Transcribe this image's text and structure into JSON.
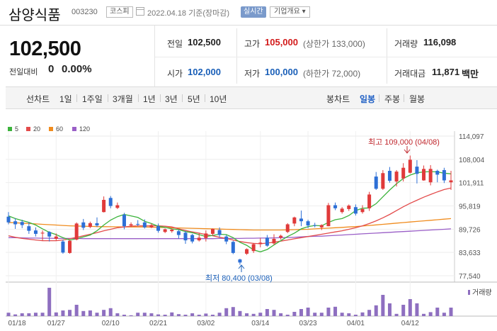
{
  "header": {
    "title": "삼양식품",
    "code": "003230",
    "market": "코스피",
    "date_text": "2022.04.18  기준(장마감)",
    "live_label": "실시간",
    "overview_label": "기업개요"
  },
  "summary": {
    "price": "102,500",
    "change_label": "전일대비",
    "change_value": "0",
    "change_percent": "0.00%",
    "stats": {
      "prev_close_label": "전일",
      "prev_close": "102,500",
      "high_label": "고가",
      "high": "105,000",
      "high_limit": "(상한가 133,000)",
      "volume_label": "거래량",
      "volume": "116,098",
      "open_label": "시가",
      "open": "102,000",
      "low_label": "저가",
      "low": "100,000",
      "low_limit": "(하한가 72,000)",
      "amount_label": "거래대금",
      "amount": "11,871",
      "amount_unit": "백만"
    }
  },
  "period_bar": {
    "line_label": "선차트",
    "line_periods": [
      "1일",
      "1주일",
      "3개월",
      "1년",
      "3년",
      "5년",
      "10년"
    ],
    "candle_label": "봉차트",
    "candle_periods": [
      "일봉",
      "주봉",
      "월봉"
    ],
    "selected": "일봉"
  },
  "colors": {
    "up": "#e03a3a",
    "down": "#2d6fd6",
    "ma5": "#3cb33c",
    "ma20": "#e34b4b",
    "ma60": "#f08c1e",
    "ma120": "#9a5fc7",
    "volume": "#8e6fc0"
  },
  "chart_data": {
    "type": "candlestick",
    "legend": [
      "5",
      "20",
      "60",
      "120"
    ],
    "y_ticks": [
      "114,097",
      "108,004",
      "101,911",
      "95,819",
      "89,726",
      "83,633",
      "77,540"
    ],
    "ylim": [
      77540,
      114097
    ],
    "x_ticks": [
      "01/18",
      "01/27",
      "02/10",
      "02/21",
      "03/02",
      "03/14",
      "03/23",
      "04/01",
      "04/12"
    ],
    "high_annotation": "최고 109,000 (04/08)",
    "low_annotation": "최저 80,400 (03/08)",
    "volume_label": "거래량",
    "candles": [
      {
        "o": 93000,
        "c": 91500,
        "h": 94200,
        "l": 91000
      },
      {
        "o": 91800,
        "c": 91000,
        "h": 92600,
        "l": 89800
      },
      {
        "o": 91600,
        "c": 90800,
        "h": 92200,
        "l": 90000
      },
      {
        "o": 90500,
        "c": 89300,
        "h": 91600,
        "l": 88500
      },
      {
        "o": 89400,
        "c": 88500,
        "h": 90200,
        "l": 87800
      },
      {
        "o": 88600,
        "c": 88800,
        "h": 89400,
        "l": 86700
      },
      {
        "o": 89000,
        "c": 87800,
        "h": 89200,
        "l": 86500
      },
      {
        "o": 87200,
        "c": 87800,
        "h": 88600,
        "l": 86800
      },
      {
        "o": 86500,
        "c": 83600,
        "h": 87000,
        "l": 83300
      },
      {
        "o": 83500,
        "c": 86700,
        "h": 86800,
        "l": 83300
      },
      {
        "o": 87000,
        "c": 91200,
        "h": 91500,
        "l": 86800
      },
      {
        "o": 91500,
        "c": 90100,
        "h": 92400,
        "l": 89500
      },
      {
        "o": 90300,
        "c": 91300,
        "h": 91700,
        "l": 90000
      },
      {
        "o": 91300,
        "c": 90700,
        "h": 92800,
        "l": 90300
      },
      {
        "o": 94200,
        "c": 97400,
        "h": 98300,
        "l": 94100
      },
      {
        "o": 97900,
        "c": 95800,
        "h": 98400,
        "l": 95200
      },
      {
        "o": 95300,
        "c": 96000,
        "h": 96700,
        "l": 95000
      },
      {
        "o": 93500,
        "c": 90500,
        "h": 94000,
        "l": 89700
      },
      {
        "o": 90700,
        "c": 91000,
        "h": 91500,
        "l": 90300
      },
      {
        "o": 91100,
        "c": 90900,
        "h": 92100,
        "l": 90500
      },
      {
        "o": 91500,
        "c": 90200,
        "h": 92300,
        "l": 89900
      },
      {
        "o": 90200,
        "c": 90800,
        "h": 91200,
        "l": 90000
      },
      {
        "o": 90500,
        "c": 89300,
        "h": 91200,
        "l": 88800
      },
      {
        "o": 89000,
        "c": 89700,
        "h": 89900,
        "l": 88700
      },
      {
        "o": 89200,
        "c": 89600,
        "h": 89900,
        "l": 88800
      },
      {
        "o": 89200,
        "c": 88200,
        "h": 89600,
        "l": 87200
      },
      {
        "o": 88800,
        "c": 86800,
        "h": 89300,
        "l": 85900
      },
      {
        "o": 88200,
        "c": 86500,
        "h": 88500,
        "l": 86000
      },
      {
        "o": 86800,
        "c": 87500,
        "h": 88700,
        "l": 86500
      },
      {
        "o": 87400,
        "c": 88600,
        "h": 89400,
        "l": 86500
      },
      {
        "o": 88500,
        "c": 89800,
        "h": 89900,
        "l": 88000
      },
      {
        "o": 89500,
        "c": 88200,
        "h": 90200,
        "l": 87600
      },
      {
        "o": 87800,
        "c": 86500,
        "h": 88200,
        "l": 85800
      },
      {
        "o": 86400,
        "c": 83500,
        "h": 86700,
        "l": 83200
      },
      {
        "o": 81800,
        "c": 81000,
        "h": 82000,
        "l": 80400
      },
      {
        "o": 83300,
        "c": 84500,
        "h": 84700,
        "l": 83000
      },
      {
        "o": 84000,
        "c": 85800,
        "h": 86100,
        "l": 83500
      },
      {
        "o": 85800,
        "c": 86200,
        "h": 87400,
        "l": 85000
      },
      {
        "o": 87500,
        "c": 85400,
        "h": 88200,
        "l": 85100
      },
      {
        "o": 86000,
        "c": 87200,
        "h": 88400,
        "l": 85600
      },
      {
        "o": 87500,
        "c": 88000,
        "h": 88300,
        "l": 87000
      },
      {
        "o": 89000,
        "c": 91000,
        "h": 91300,
        "l": 88700
      },
      {
        "o": 91200,
        "c": 92800,
        "h": 93000,
        "l": 90500
      },
      {
        "o": 92500,
        "c": 91800,
        "h": 94600,
        "l": 90500
      },
      {
        "o": 91800,
        "c": 90700,
        "h": 92200,
        "l": 90000
      },
      {
        "o": 90800,
        "c": 90700,
        "h": 91400,
        "l": 90200
      },
      {
        "o": 90200,
        "c": 90800,
        "h": 91000,
        "l": 89500
      },
      {
        "o": 90500,
        "c": 96000,
        "h": 96600,
        "l": 90500
      },
      {
        "o": 96000,
        "c": 95200,
        "h": 96700,
        "l": 94700
      },
      {
        "o": 94200,
        "c": 95100,
        "h": 95500,
        "l": 93800
      },
      {
        "o": 95000,
        "c": 95900,
        "h": 96200,
        "l": 94500
      },
      {
        "o": 95500,
        "c": 93800,
        "h": 96200,
        "l": 93300
      },
      {
        "o": 94200,
        "c": 95000,
        "h": 96000,
        "l": 93800
      },
      {
        "o": 95200,
        "c": 98800,
        "h": 99500,
        "l": 94500
      },
      {
        "o": 103500,
        "c": 100300,
        "h": 104700,
        "l": 100000
      },
      {
        "o": 100300,
        "c": 104400,
        "h": 105200,
        "l": 100000
      },
      {
        "o": 105000,
        "c": 102400,
        "h": 106000,
        "l": 101900
      },
      {
        "o": 102200,
        "c": 104800,
        "h": 105200,
        "l": 100900
      },
      {
        "o": 103000,
        "c": 105800,
        "h": 107000,
        "l": 102200
      },
      {
        "o": 104500,
        "c": 107900,
        "h": 109000,
        "l": 104300
      },
      {
        "o": 106100,
        "c": 104200,
        "h": 107800,
        "l": 101700
      },
      {
        "o": 102500,
        "c": 105500,
        "h": 106400,
        "l": 102400
      },
      {
        "o": 102000,
        "c": 105500,
        "h": 106500,
        "l": 101200
      },
      {
        "o": 105000,
        "c": 104000,
        "h": 105300,
        "l": 102000
      },
      {
        "o": 105200,
        "c": 102500,
        "h": 105800,
        "l": 101800
      },
      {
        "o": 102000,
        "c": 102500,
        "h": 105000,
        "l": 100000
      }
    ],
    "ma5": [
      93200,
      92500,
      92000,
      91500,
      90800,
      89800,
      88900,
      88300,
      87500,
      86900,
      87200,
      87700,
      88200,
      89300,
      90800,
      92100,
      93000,
      93600,
      93200,
      92800,
      91800,
      91200,
      90500,
      90200,
      89800,
      89600,
      89100,
      88800,
      88300,
      87800,
      88100,
      88400,
      88300,
      87500,
      86300,
      85500,
      84300,
      83800,
      84400,
      85600,
      86700,
      87800,
      88700,
      89800,
      90400,
      90700,
      90600,
      91500,
      92200,
      92500,
      93300,
      94600,
      95200,
      95300,
      96400,
      98200,
      100000,
      101600,
      103000,
      103900,
      104500,
      104700,
      104800,
      104700,
      104400,
      104200
    ],
    "ma20": [
      88000,
      87600,
      87300,
      87100,
      86900,
      86700,
      86700,
      86700,
      86900,
      87200,
      87600,
      88000,
      88400,
      88800,
      89300,
      89700,
      90100,
      90300,
      90500,
      90600,
      90600,
      90600,
      90600,
      90500,
      90300,
      89800,
      89400,
      89000,
      88700,
      88300,
      88000,
      87600,
      87300,
      86900,
      86500,
      86200,
      86000,
      85900,
      86100,
      86300,
      86600,
      86900,
      87200,
      87500,
      87800,
      88100,
      88400,
      88700,
      89000,
      89300,
      89700,
      90100,
      90600,
      91200,
      91900,
      92700,
      93600,
      94600,
      95600,
      96500,
      97300,
      98100,
      98800,
      99500,
      100100,
      100500
    ],
    "ma60": [
      91500,
      91400,
      91300,
      91200,
      91100,
      91000,
      90900,
      90800,
      90700,
      90600,
      90550,
      90500,
      90450,
      90400,
      90380,
      90360,
      90340,
      90320,
      90300,
      90300,
      90300,
      90250,
      90200,
      90150,
      90100,
      90050,
      90000,
      89950,
      89900,
      89850,
      89800,
      89750,
      89700,
      89650,
      89600,
      89550,
      89500,
      89500,
      89500,
      89500,
      89500,
      89550,
      89600,
      89650,
      89700,
      89800,
      89900,
      90000,
      90100,
      90200,
      90300,
      90400,
      90550,
      90700,
      90850,
      91000,
      91150,
      91300,
      91450,
      91600,
      91750,
      91900,
      92050,
      92200,
      92350,
      92500
    ],
    "ma120": [
      87500,
      87500,
      87450,
      87400,
      87400,
      87350,
      87350,
      87300,
      87300,
      87300,
      87300,
      87250,
      87250,
      87250,
      87250,
      87250,
      87250,
      87250,
      87250,
      87250,
      87250,
      87250,
      87250,
      87250,
      87250,
      87250,
      87250,
      87250,
      87250,
      87250,
      87250,
      87300,
      87300,
      87300,
      87300,
      87350,
      87350,
      87400,
      87400,
      87450,
      87500,
      87550,
      87600,
      87700,
      87800,
      87850,
      87900,
      88000,
      88100,
      88200,
      88300,
      88400,
      88500,
      88600,
      88700,
      88800,
      88900,
      89000,
      89100,
      89200,
      89300,
      89400,
      89500,
      89600,
      89700,
      89800
    ],
    "volume": [
      0.12,
      0.06,
      0.1,
      0.1,
      0.12,
      0.12,
      1.0,
      0.13,
      0.2,
      0.22,
      0.4,
      0.18,
      0.2,
      0.12,
      0.22,
      0.28,
      0.1,
      0.05,
      0.03,
      0.12,
      0.12,
      0.1,
      0.06,
      0.05,
      0.13,
      0.07,
      0.05,
      0.1,
      0.05,
      0.09,
      0.05,
      0.12,
      0.28,
      0.32,
      0.18,
      0.1,
      0.08,
      0.12,
      0.25,
      0.22,
      0.1,
      0.05,
      0.15,
      0.25,
      0.3,
      0.12,
      0.12,
      0.3,
      0.33,
      0.12,
      0.1,
      0.05,
      0.13,
      0.22,
      0.38,
      0.75,
      0.45,
      0.08,
      0.4,
      0.6,
      0.45,
      0.08,
      0.14,
      0.3,
      0.12,
      0.3
    ]
  }
}
